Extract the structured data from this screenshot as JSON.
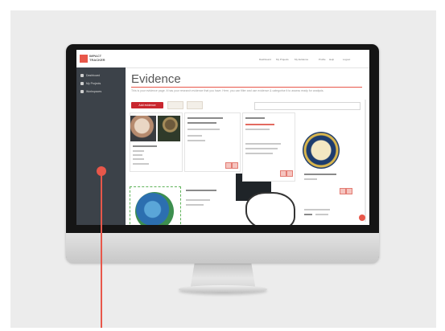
{
  "app": {
    "logo_text": "IMPACT\nTRACKER",
    "nav_items": [
      "Dashboard",
      "My Projects",
      "My Evidence",
      "Profile",
      "Help",
      "Logout"
    ]
  },
  "sidebar": {
    "items": [
      {
        "label": "Dashboard",
        "icon": "home-icon"
      },
      {
        "label": "My Projects",
        "icon": "pin-icon"
      },
      {
        "label": "Workspaces",
        "icon": "gear-icon"
      }
    ]
  },
  "main": {
    "title": "Evidence",
    "intro": "This is your evidence page. It has your research evidence that you have. Here, you can filter and use evidence & categorise it to assess ready for analysis.",
    "add_button": "Add evidence",
    "search_placeholder": ""
  },
  "colors": {
    "accent": "#e8574a",
    "sidebar": "#3c4249",
    "add_button": "#c9262e"
  },
  "device": {
    "brand_icon": "apple-logo-icon"
  }
}
